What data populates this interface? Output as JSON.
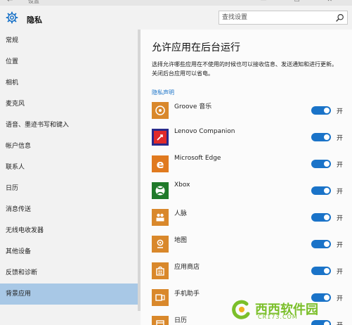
{
  "titlebar": {
    "title": "设置",
    "back_icon": "back-arrow-icon",
    "controls": [
      "—",
      "☐",
      "✕"
    ]
  },
  "header": {
    "title": "隐私"
  },
  "search": {
    "placeholder": "查找设置"
  },
  "sidebar": {
    "items": [
      {
        "label": "常规",
        "selected": false
      },
      {
        "label": "位置",
        "selected": false
      },
      {
        "label": "相机",
        "selected": false
      },
      {
        "label": "麦克风",
        "selected": false
      },
      {
        "label": "语音、墨迹书写和键入",
        "selected": false
      },
      {
        "label": "帐户信息",
        "selected": false
      },
      {
        "label": "联系人",
        "selected": false
      },
      {
        "label": "日历",
        "selected": false
      },
      {
        "label": "消息传送",
        "selected": false
      },
      {
        "label": "无线电收发器",
        "selected": false
      },
      {
        "label": "其他设备",
        "selected": false
      },
      {
        "label": "反馈和诊断",
        "selected": false
      },
      {
        "label": "背景应用",
        "selected": true
      }
    ]
  },
  "main": {
    "title": "允许应用在后台运行",
    "description": "选择允许哪些应用在不使用的时候也可以接收信息、发送通知和进行更新。关闭后台应用可以省电。",
    "privacy_link": "隐私声明",
    "apps": [
      {
        "name": "Groove 音乐",
        "icon": "groove-music-icon",
        "icon_bg": "#d9882b",
        "enabled": true,
        "state_label": "开"
      },
      {
        "name": "Lenovo Companion",
        "icon": "lenovo-companion-icon",
        "icon_bg": "#e02a2a",
        "enabled": true,
        "state_label": "开"
      },
      {
        "name": "Microsoft Edge",
        "icon": "edge-icon",
        "icon_bg": "#e07a1f",
        "enabled": true,
        "state_label": "开"
      },
      {
        "name": "Xbox",
        "icon": "xbox-icon",
        "icon_bg": "#1f7a2a",
        "enabled": true,
        "state_label": "开"
      },
      {
        "name": "人脉",
        "icon": "people-icon",
        "icon_bg": "#d9882b",
        "enabled": true,
        "state_label": "开"
      },
      {
        "name": "地图",
        "icon": "maps-icon",
        "icon_bg": "#d9882b",
        "enabled": true,
        "state_label": "开"
      },
      {
        "name": "应用商店",
        "icon": "store-icon",
        "icon_bg": "#d9882b",
        "enabled": true,
        "state_label": "开"
      },
      {
        "name": "手机助手",
        "icon": "phone-companion-icon",
        "icon_bg": "#d9882b",
        "enabled": true,
        "state_label": "开"
      },
      {
        "name": "日历",
        "icon": "calendar-icon",
        "icon_bg": "#d9882b",
        "enabled": true,
        "state_label": "开"
      }
    ]
  },
  "watermark": {
    "text": "西西软件园",
    "url": "CR173.COM",
    "color": "#7bbf2a"
  },
  "colors": {
    "accent": "#1a73c8",
    "sidebar_selected": "#a8c8e6",
    "tile_orange": "#d9882b"
  }
}
